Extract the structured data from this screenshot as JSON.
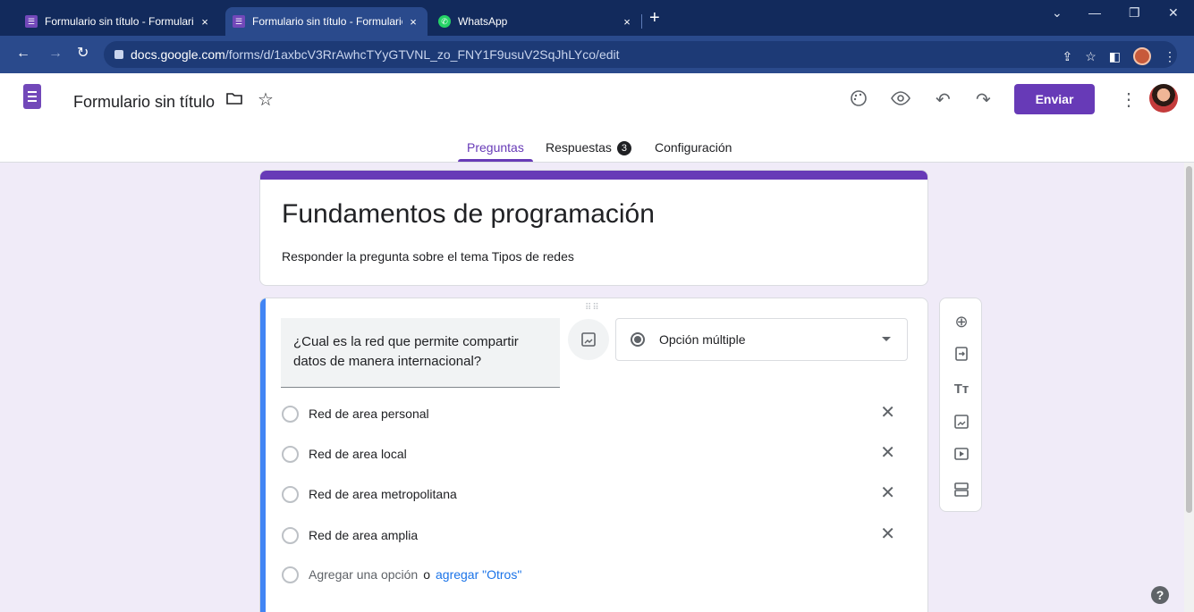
{
  "browser": {
    "tabs": [
      {
        "label": "Formulario sin título - Formulario",
        "icon": "forms-icon",
        "close": "×"
      },
      {
        "label": "Formulario sin título - Formulario",
        "icon": "forms-icon",
        "close": "×"
      },
      {
        "label": "WhatsApp",
        "icon": "whatsapp-icon",
        "close": "×"
      }
    ],
    "new_tab": "+",
    "url_host": "docs.google.com",
    "url_path": "/forms/d/1axbcV3RrAwhcTYyGTVNL_zo_FNY1F9usuV2SqJhLYco/edit"
  },
  "header": {
    "doc_title": "Formulario sin título",
    "send_label": "Enviar",
    "tabs": {
      "questions": "Preguntas",
      "responses": "Respuestas",
      "responses_count": "3",
      "settings": "Configuración"
    }
  },
  "form": {
    "title": "Fundamentos de programación",
    "description": "Responder la pregunta sobre el tema Tipos de redes"
  },
  "question": {
    "text": "¿Cual es la red que permite compartir datos de manera internacional?",
    "type": "Opción múltiple",
    "options": [
      "Red de area personal",
      "Red de area local",
      "Red de area metropolitana",
      "Red de area amplia"
    ],
    "add_option": "Agregar una opción",
    "or": "o",
    "add_other": "agregar \"Otros\""
  },
  "colors": {
    "accent": "#673ab7",
    "page_bg": "#f0ebf8",
    "active_bar": "#4285f4",
    "browser_frame": "#122a5c"
  }
}
